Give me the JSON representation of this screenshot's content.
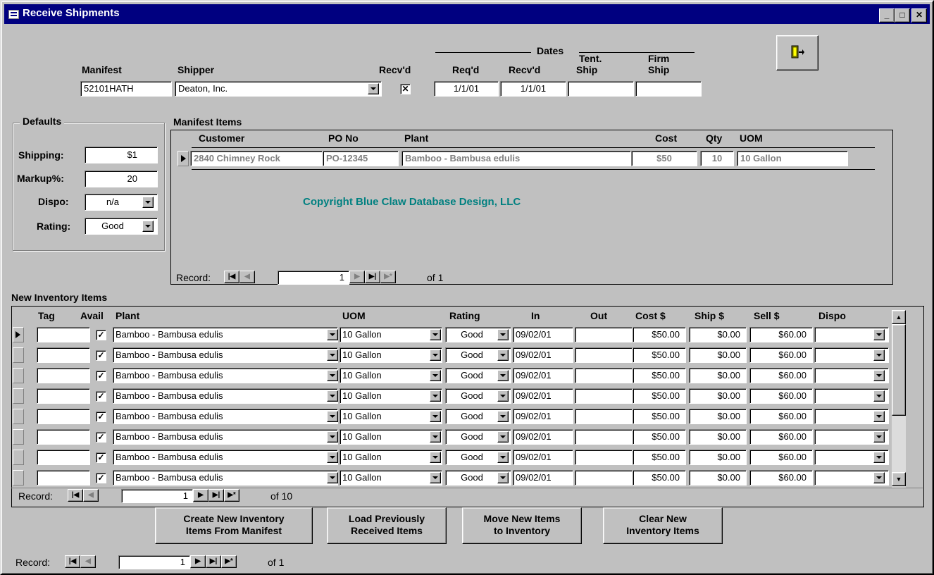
{
  "window": {
    "title": "Receive Shipments",
    "minimize_label": "_",
    "maximize_label": "□",
    "close_label": "✕"
  },
  "header": {
    "manifest_label": "Manifest",
    "manifest_value": "52101HATH",
    "shipper_label": "Shipper",
    "shipper_value": "Deaton, Inc.",
    "recvd_label": "Recv'd",
    "recvd_checked": true,
    "dates_label": "Dates",
    "reqd_label": "Req'd",
    "reqd_value": "1/1/01",
    "recvd_date_label": "Recv'd",
    "recvd_date_value": "1/1/01",
    "tent_label_1": "Tent.",
    "tent_label_2": "Ship",
    "tent_value": "",
    "firm_label_1": "Firm",
    "firm_label_2": "Ship",
    "firm_value": ""
  },
  "defaults": {
    "title": "Defaults",
    "shipping_label": "Shipping:",
    "shipping_value": "$1",
    "markup_label": "Markup%:",
    "markup_value": "20",
    "dispo_label": "Dispo:",
    "dispo_value": "n/a",
    "rating_label": "Rating:",
    "rating_value": "Good"
  },
  "manifest_items": {
    "title": "Manifest Items",
    "columns": [
      "Customer",
      "PO No",
      "Plant",
      "Cost",
      "Qty",
      "UOM"
    ],
    "row": {
      "customer": "2840 Chimney Rock",
      "po": "PO-12345",
      "plant": "Bamboo - Bambusa edulis",
      "cost": "$50",
      "qty": "10",
      "uom": "10 Gallon"
    },
    "copyright": "Copyright Blue Claw Database Design, LLC",
    "record_label": "Record:",
    "record_current": "1",
    "record_of": "of  1"
  },
  "inventory": {
    "title": "New Inventory Items",
    "columns": [
      "Tag",
      "Avail",
      "Plant",
      "UOM",
      "Rating",
      "In",
      "Out",
      "Cost $",
      "Ship $",
      "Sell $",
      "Dispo"
    ],
    "rows": [
      {
        "tag": "",
        "avail": true,
        "plant": "Bamboo - Bambusa edulis",
        "uom": "10 Gallon",
        "rating": "Good",
        "in": "09/02/01",
        "out": "",
        "cost": "$50.00",
        "ship": "$0.00",
        "sell": "$60.00",
        "dispo": ""
      },
      {
        "tag": "",
        "avail": true,
        "plant": "Bamboo - Bambusa edulis",
        "uom": "10 Gallon",
        "rating": "Good",
        "in": "09/02/01",
        "out": "",
        "cost": "$50.00",
        "ship": "$0.00",
        "sell": "$60.00",
        "dispo": ""
      },
      {
        "tag": "",
        "avail": true,
        "plant": "Bamboo - Bambusa edulis",
        "uom": "10 Gallon",
        "rating": "Good",
        "in": "09/02/01",
        "out": "",
        "cost": "$50.00",
        "ship": "$0.00",
        "sell": "$60.00",
        "dispo": ""
      },
      {
        "tag": "",
        "avail": true,
        "plant": "Bamboo - Bambusa edulis",
        "uom": "10 Gallon",
        "rating": "Good",
        "in": "09/02/01",
        "out": "",
        "cost": "$50.00",
        "ship": "$0.00",
        "sell": "$60.00",
        "dispo": ""
      },
      {
        "tag": "",
        "avail": true,
        "plant": "Bamboo - Bambusa edulis",
        "uom": "10 Gallon",
        "rating": "Good",
        "in": "09/02/01",
        "out": "",
        "cost": "$50.00",
        "ship": "$0.00",
        "sell": "$60.00",
        "dispo": ""
      },
      {
        "tag": "",
        "avail": true,
        "plant": "Bamboo - Bambusa edulis",
        "uom": "10 Gallon",
        "rating": "Good",
        "in": "09/02/01",
        "out": "",
        "cost": "$50.00",
        "ship": "$0.00",
        "sell": "$60.00",
        "dispo": ""
      },
      {
        "tag": "",
        "avail": true,
        "plant": "Bamboo - Bambusa edulis",
        "uom": "10 Gallon",
        "rating": "Good",
        "in": "09/02/01",
        "out": "",
        "cost": "$50.00",
        "ship": "$0.00",
        "sell": "$60.00",
        "dispo": ""
      },
      {
        "tag": "",
        "avail": true,
        "plant": "Bamboo - Bambusa edulis",
        "uom": "10 Gallon",
        "rating": "Good",
        "in": "09/02/01",
        "out": "",
        "cost": "$50.00",
        "ship": "$0.00",
        "sell": "$60.00",
        "dispo": ""
      }
    ],
    "record_label": "Record:",
    "record_current": "1",
    "record_of": "of  10"
  },
  "buttons": {
    "create_1": "Create New Inventory",
    "create_2": "Items From Manifest",
    "load_1": "Load Previously",
    "load_2": "Received Items",
    "move_1": "Move New Items",
    "move_2": "to Inventory",
    "clear_1": "Clear New",
    "clear_2": "Inventory Items"
  },
  "form_record": {
    "record_label": "Record:",
    "record_current": "1",
    "record_of": "of  1"
  },
  "icons": {
    "exit": "exit-door-icon",
    "first": "first-record-icon",
    "prev": "previous-record-icon",
    "next": "next-record-icon",
    "last": "last-record-icon",
    "new": "new-record-icon"
  },
  "colors": {
    "titlebar": "#000080",
    "face": "#c0c0c0",
    "copyright": "#008080"
  }
}
